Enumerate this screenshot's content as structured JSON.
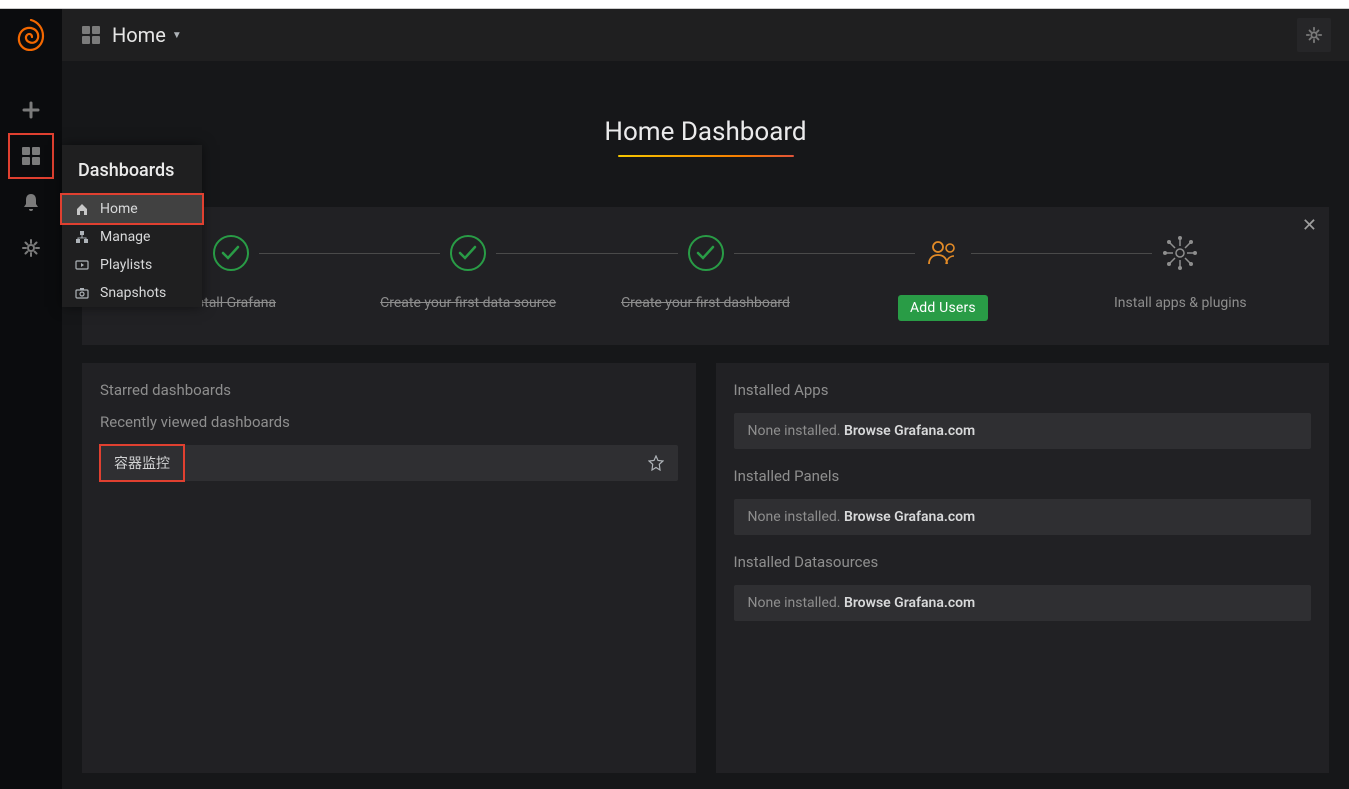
{
  "breadcrumb": {
    "title": "Home"
  },
  "page": {
    "title": "Home Dashboard"
  },
  "flyout": {
    "title": "Dashboards",
    "items": [
      {
        "label": "Home"
      },
      {
        "label": "Manage"
      },
      {
        "label": "Playlists"
      },
      {
        "label": "Snapshots"
      }
    ]
  },
  "steps": {
    "s1": "Install Grafana",
    "s2": "Create your first data source",
    "s3": "Create your first dashboard",
    "s4_btn": "Add Users",
    "s5": "Install apps & plugins"
  },
  "left_panel": {
    "starred_title": "Starred dashboards",
    "recent_title": "Recently viewed dashboards",
    "recent_item": "容器监控"
  },
  "right_panel": {
    "apps_title": "Installed Apps",
    "panels_title": "Installed Panels",
    "ds_title": "Installed Datasources",
    "none_prefix": "None installed. ",
    "browse": "Browse Grafana.com"
  }
}
